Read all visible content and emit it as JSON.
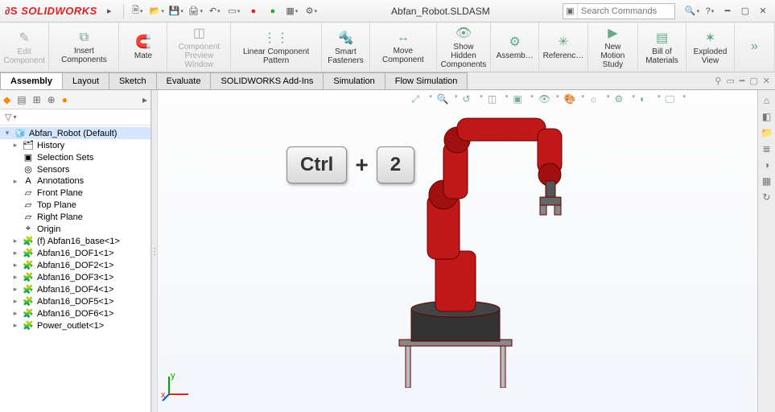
{
  "app": {
    "logo": "SOLIDWORKS",
    "document_title": "Abfan_Robot.SLDASM"
  },
  "search": {
    "placeholder": "Search Commands"
  },
  "qat": [
    "new",
    "open",
    "save",
    "print",
    "undo",
    "select",
    "rec",
    "stop",
    "options",
    "gear"
  ],
  "ribbon": [
    {
      "id": "edit-component",
      "label": "Edit\nComponent",
      "icon": "✎",
      "disabled": true
    },
    {
      "id": "insert-components",
      "label": "Insert Components",
      "icon": "⧉"
    },
    {
      "id": "mate",
      "label": "Mate",
      "icon": "🧲"
    },
    {
      "id": "component-preview",
      "label": "Component\nPreview Window",
      "icon": "◫",
      "disabled": true
    },
    {
      "id": "linear-pattern",
      "label": "Linear Component Pattern",
      "icon": "⋮⋮"
    },
    {
      "id": "smart-fasteners",
      "label": "Smart\nFasteners",
      "icon": "🔩"
    },
    {
      "id": "move-component",
      "label": "Move Component",
      "icon": "↔"
    },
    {
      "id": "show-hidden",
      "label": "Show Hidden\nComponents",
      "icon": "👁"
    },
    {
      "id": "assembly",
      "label": "Assemb…",
      "icon": "⚙"
    },
    {
      "id": "reference",
      "label": "Referenc…",
      "icon": "✳"
    },
    {
      "id": "motion-study",
      "label": "New Motion\nStudy",
      "icon": "▶"
    },
    {
      "id": "bom",
      "label": "Bill of\nMaterials",
      "icon": "▤"
    },
    {
      "id": "exploded-view",
      "label": "Exploded\nView",
      "icon": "✶"
    }
  ],
  "tabs": {
    "items": [
      "Assembly",
      "Layout",
      "Sketch",
      "Evaluate",
      "SOLIDWORKS Add-Ins",
      "Simulation",
      "Flow Simulation"
    ],
    "active": 0
  },
  "left_panel": {
    "toolbar_icons": [
      "cube",
      "list",
      "tree",
      "target",
      "sphere"
    ],
    "filter_label": "▽",
    "tree": [
      {
        "label": "Abfan_Robot  (Default)",
        "icon": "🧊",
        "twist": "▾",
        "depth": 0,
        "root": true
      },
      {
        "label": "History",
        "icon": "🗂",
        "twist": "▸",
        "depth": 1
      },
      {
        "label": "Selection Sets",
        "icon": "▣",
        "twist": "",
        "depth": 1
      },
      {
        "label": "Sensors",
        "icon": "◎",
        "twist": "",
        "depth": 1
      },
      {
        "label": "Annotations",
        "icon": "A",
        "twist": "▸",
        "depth": 1
      },
      {
        "label": "Front Plane",
        "icon": "▱",
        "twist": "",
        "depth": 1
      },
      {
        "label": "Top Plane",
        "icon": "▱",
        "twist": "",
        "depth": 1
      },
      {
        "label": "Right Plane",
        "icon": "▱",
        "twist": "",
        "depth": 1
      },
      {
        "label": "Origin",
        "icon": "⌖",
        "twist": "",
        "depth": 1
      },
      {
        "label": "(f) Abfan16_base<1>",
        "icon": "🧩",
        "twist": "▸",
        "depth": 1
      },
      {
        "label": "Abfan16_DOF1<1>",
        "icon": "🧩",
        "twist": "▸",
        "depth": 1
      },
      {
        "label": "Abfan16_DOF2<1>",
        "icon": "🧩",
        "twist": "▸",
        "depth": 1
      },
      {
        "label": "Abfan16_DOF3<1>",
        "icon": "🧩",
        "twist": "▸",
        "depth": 1
      },
      {
        "label": "Abfan16_DOF4<1>",
        "icon": "🧩",
        "twist": "▸",
        "depth": 1
      },
      {
        "label": "Abfan16_DOF5<1>",
        "icon": "🧩",
        "twist": "▸",
        "depth": 1
      },
      {
        "label": "Abfan16_DOF6<1>",
        "icon": "🧩",
        "twist": "▸",
        "depth": 1
      },
      {
        "label": "Power_outlet<1>",
        "icon": "🧩",
        "twist": "▸",
        "depth": 1
      }
    ]
  },
  "viewport_toolbar": [
    "zoom-fit",
    "zoom-area",
    "prev-view",
    "section",
    "display-style",
    "hide-show",
    "edit-appearance",
    "apply-scene",
    "view-settings",
    "render",
    "screen"
  ],
  "rightbar_icons": [
    "home",
    "cube",
    "folder",
    "layers",
    "palette",
    "grid",
    "refresh"
  ],
  "overlay": {
    "key1": "Ctrl",
    "plus": "+",
    "key2": "2"
  },
  "triad": {
    "x": "x",
    "y": "y"
  },
  "colors": {
    "brand": "#d22",
    "robot_body": "#c01818",
    "robot_dark": "#3a3a3a"
  }
}
